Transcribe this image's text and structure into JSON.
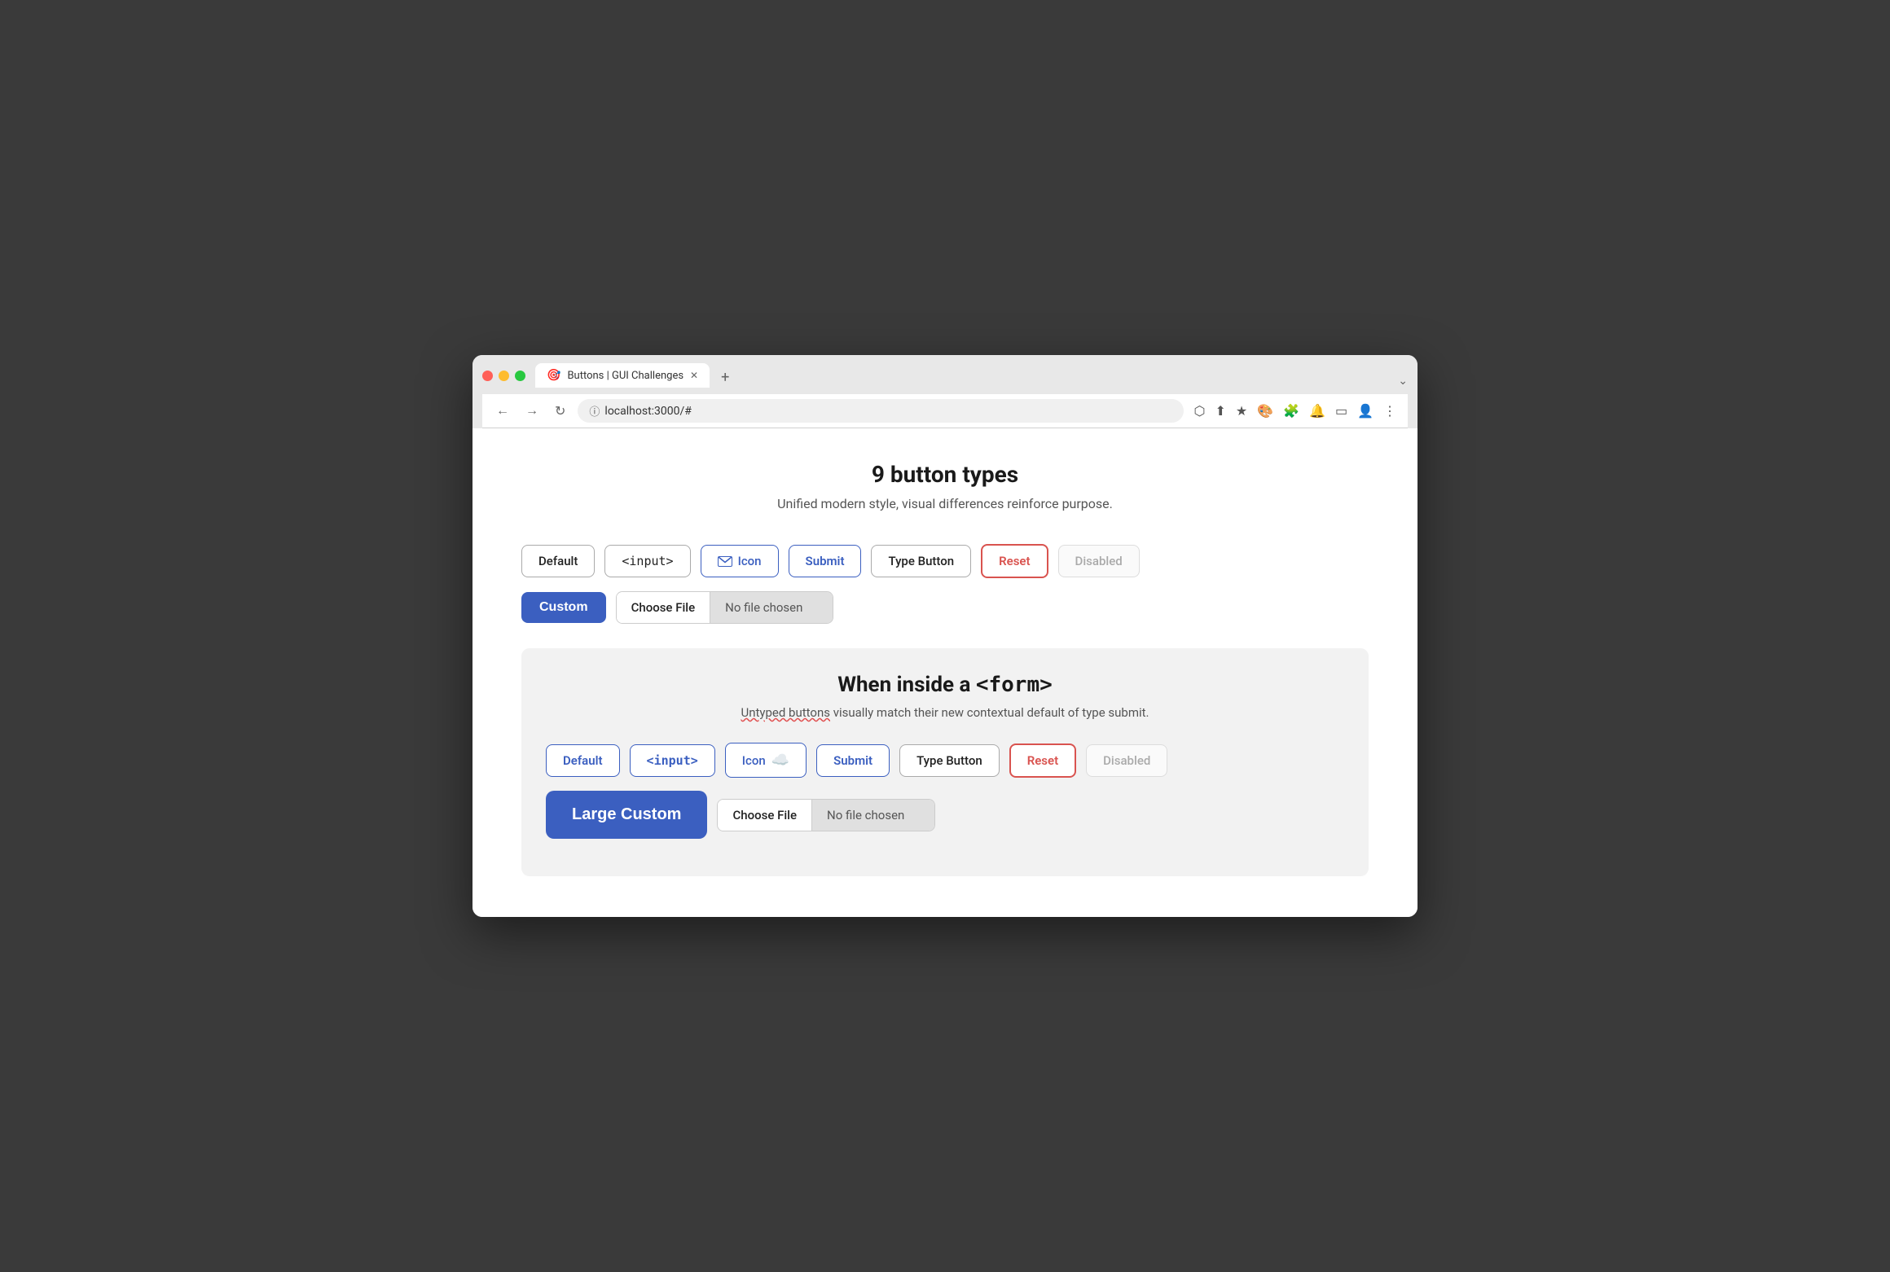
{
  "browser": {
    "tab_title": "Buttons | GUI Challenges",
    "tab_favicon": "🎯",
    "url": "localhost:3000/#",
    "new_tab_icon": "+",
    "expand_icon": "⌄"
  },
  "nav": {
    "back": "←",
    "forward": "→",
    "refresh": "↻",
    "security_icon": "ⓘ"
  },
  "toolbar": {
    "icons": [
      "⬡",
      "⬆",
      "★",
      "🎨",
      "🧩",
      "🔔",
      "▭",
      "👤",
      "⋮"
    ]
  },
  "page": {
    "title": "9 button types",
    "subtitle": "Unified modern style, visual differences reinforce purpose."
  },
  "buttons_section": {
    "row1": [
      {
        "id": "default",
        "label": "Default",
        "type": "default"
      },
      {
        "id": "input",
        "label": "<input>",
        "type": "input"
      },
      {
        "id": "icon",
        "label": "Icon",
        "type": "icon"
      },
      {
        "id": "submit",
        "label": "Submit",
        "type": "submit"
      },
      {
        "id": "type-button",
        "label": "Type Button",
        "type": "type-button"
      },
      {
        "id": "reset",
        "label": "Reset",
        "type": "reset"
      },
      {
        "id": "disabled",
        "label": "Disabled",
        "type": "disabled"
      }
    ],
    "row2_custom_label": "Custom",
    "row2_file_label": "Choose File",
    "row2_no_file": "No file chosen"
  },
  "form_section": {
    "title_prefix": "When inside a ",
    "title_code": "<form>",
    "subtitle_part1": "Untyped buttons",
    "subtitle_part2": " visually match their new contextual default of type submit.",
    "row1": [
      {
        "id": "default-form",
        "label": "Default",
        "type": "default-submit"
      },
      {
        "id": "input-form",
        "label": "<input>",
        "type": "input-submit"
      },
      {
        "id": "icon-form",
        "label": "Icon",
        "type": "icon-submit"
      },
      {
        "id": "submit-form",
        "label": "Submit",
        "type": "submit"
      },
      {
        "id": "type-button-form",
        "label": "Type Button",
        "type": "type-button"
      },
      {
        "id": "reset-form",
        "label": "Reset",
        "type": "reset"
      },
      {
        "id": "disabled-form",
        "label": "Disabled",
        "type": "disabled"
      }
    ],
    "row2_custom_label": "Large Custom",
    "row2_file_label": "Choose File",
    "row2_no_file": "No file chosen"
  }
}
